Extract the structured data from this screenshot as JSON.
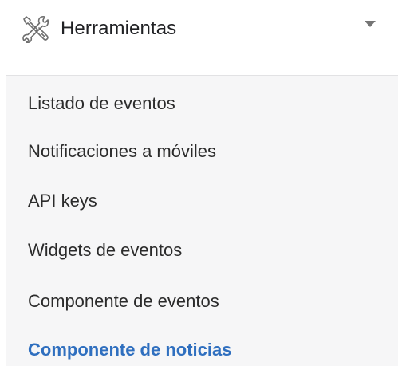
{
  "header": {
    "icon": "tools-icon",
    "label": "Herramientas",
    "caret_icon": "caret-down-icon"
  },
  "submenu": {
    "items": [
      {
        "label": "Listado de eventos",
        "active": false
      },
      {
        "label": "Notificaciones a móviles",
        "active": false
      },
      {
        "label": "API keys",
        "active": false
      },
      {
        "label": "Widgets de eventos",
        "active": false
      },
      {
        "label": "Componente de eventos",
        "active": false
      },
      {
        "label": "Componente de noticias",
        "active": true
      }
    ]
  },
  "colors": {
    "active_text": "#2f6fbf",
    "submenu_bg": "#f6f6f7",
    "text": "#2b2b2b"
  }
}
